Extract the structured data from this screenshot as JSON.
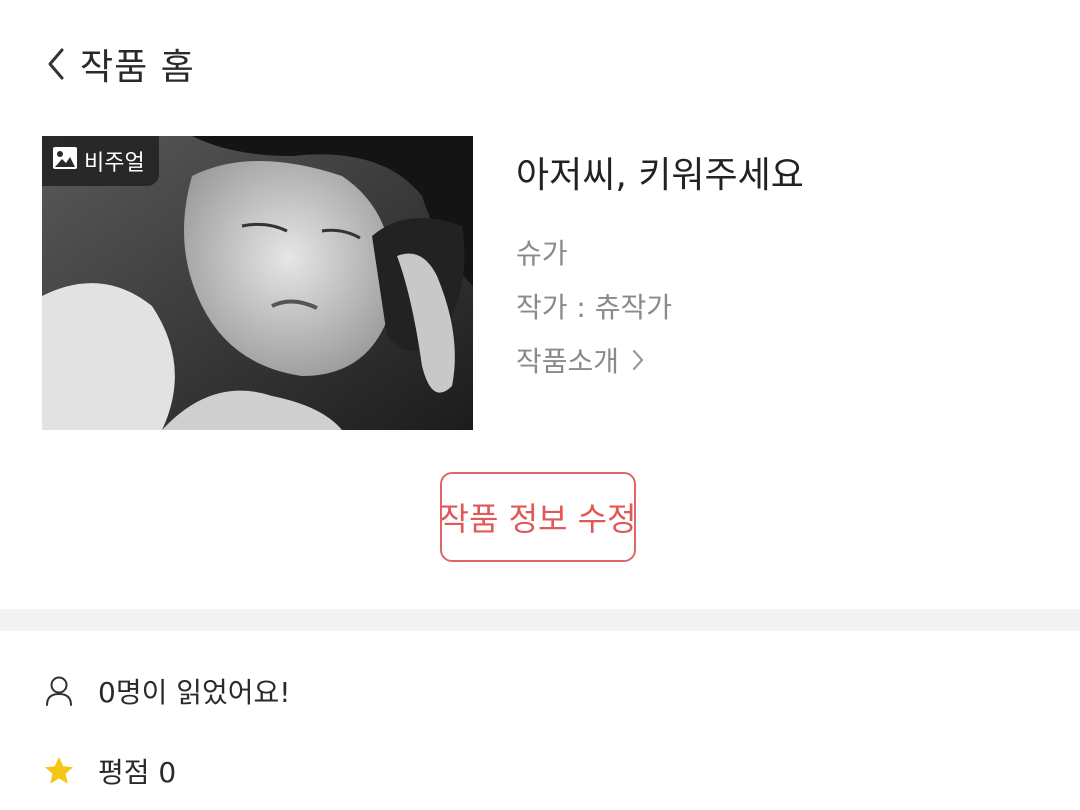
{
  "header": {
    "back_icon": "chevron-left-icon",
    "title": "작품 홈"
  },
  "cover": {
    "badge_icon": "image-icon",
    "badge_label": "비주얼"
  },
  "work": {
    "title": "아저씨, 키워주세요",
    "character": "슈가",
    "author": "작가 : 츄작가",
    "intro_label": "작품소개"
  },
  "actions": {
    "edit_label": "작품 정보 수정",
    "accent_color": "#e06666"
  },
  "stats": {
    "readers_icon": "user-icon",
    "readers_text": "0명이 읽었어요!",
    "rating_icon": "star-icon",
    "rating_text": "평점 0",
    "star_color": "#f5c518"
  }
}
